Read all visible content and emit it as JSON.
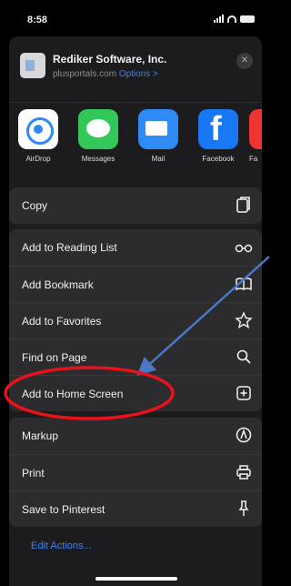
{
  "status_bar": {
    "time": "8:58"
  },
  "share_header": {
    "title": "Rediker Software, Inc.",
    "domain": "plusportals.com",
    "options_label": "Options >",
    "close_label": "✕"
  },
  "apps": [
    {
      "label": "AirDrop",
      "icon": "airdrop-icon"
    },
    {
      "label": "Messages",
      "icon": "messages-icon"
    },
    {
      "label": "Mail",
      "icon": "mail-icon"
    },
    {
      "label": "Facebook",
      "icon": "facebook-icon",
      "glyph": "f"
    },
    {
      "label": "Fa",
      "icon": "partial-app-icon"
    }
  ],
  "actions": {
    "copy": {
      "label": "Copy",
      "icon": "copy-icon"
    },
    "group1": [
      {
        "label": "Add to Reading List",
        "icon": "glasses-icon"
      },
      {
        "label": "Add Bookmark",
        "icon": "book-icon"
      },
      {
        "label": "Add to Favorites",
        "icon": "star-icon"
      },
      {
        "label": "Find on Page",
        "icon": "search-icon"
      },
      {
        "label": "Add to Home Screen",
        "icon": "add-square-icon"
      }
    ],
    "group2": [
      {
        "label": "Markup",
        "icon": "markup-icon"
      },
      {
        "label": "Print",
        "icon": "printer-icon"
      },
      {
        "label": "Save to Pinterest",
        "icon": "pin-icon"
      }
    ]
  },
  "edit_actions_label": "Edit Actions...",
  "annotation_color": "#e8121c",
  "arrow_color": "#4a78c8"
}
